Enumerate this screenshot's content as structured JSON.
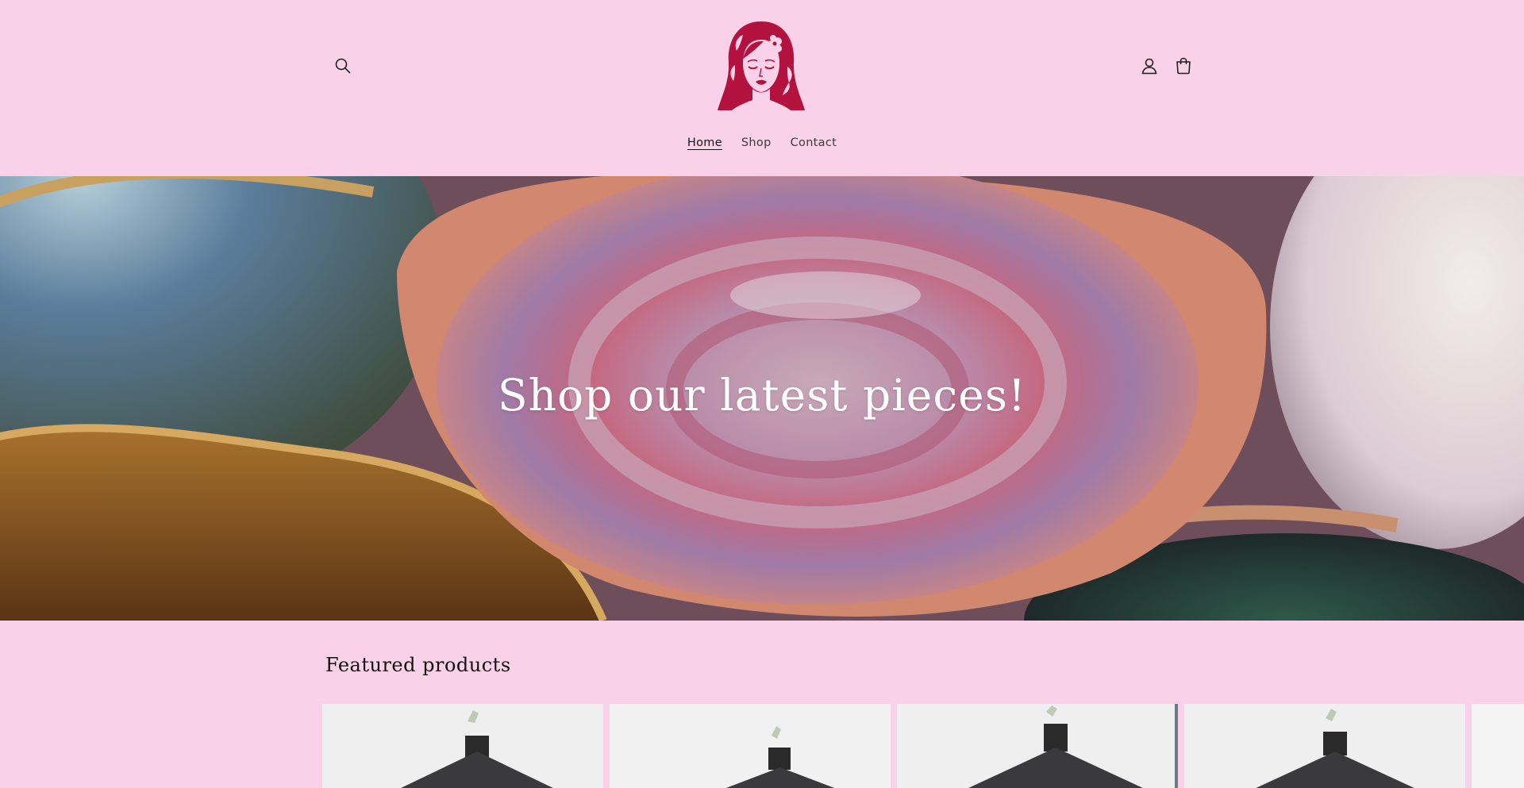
{
  "header": {
    "search_icon": "search-icon",
    "account_icon": "account-icon",
    "cart_icon": "cart-icon",
    "logo_icon": "woman-face-logo",
    "brand_color": "#b3123f"
  },
  "nav": {
    "items": [
      {
        "label": "Home",
        "active": true
      },
      {
        "label": "Shop",
        "active": false
      },
      {
        "label": "Contact",
        "active": false
      }
    ]
  },
  "hero": {
    "title": "Shop our latest pieces!"
  },
  "featured": {
    "title": "Featured products",
    "products": [
      {
        "image": "ceramic-house"
      },
      {
        "image": "ceramic-house"
      },
      {
        "image": "ceramic-house"
      },
      {
        "image": "ceramic-house"
      },
      {
        "image": "ceramic-house"
      }
    ]
  },
  "colors": {
    "background": "#f9d1e8",
    "text": "#1f1f1f"
  }
}
